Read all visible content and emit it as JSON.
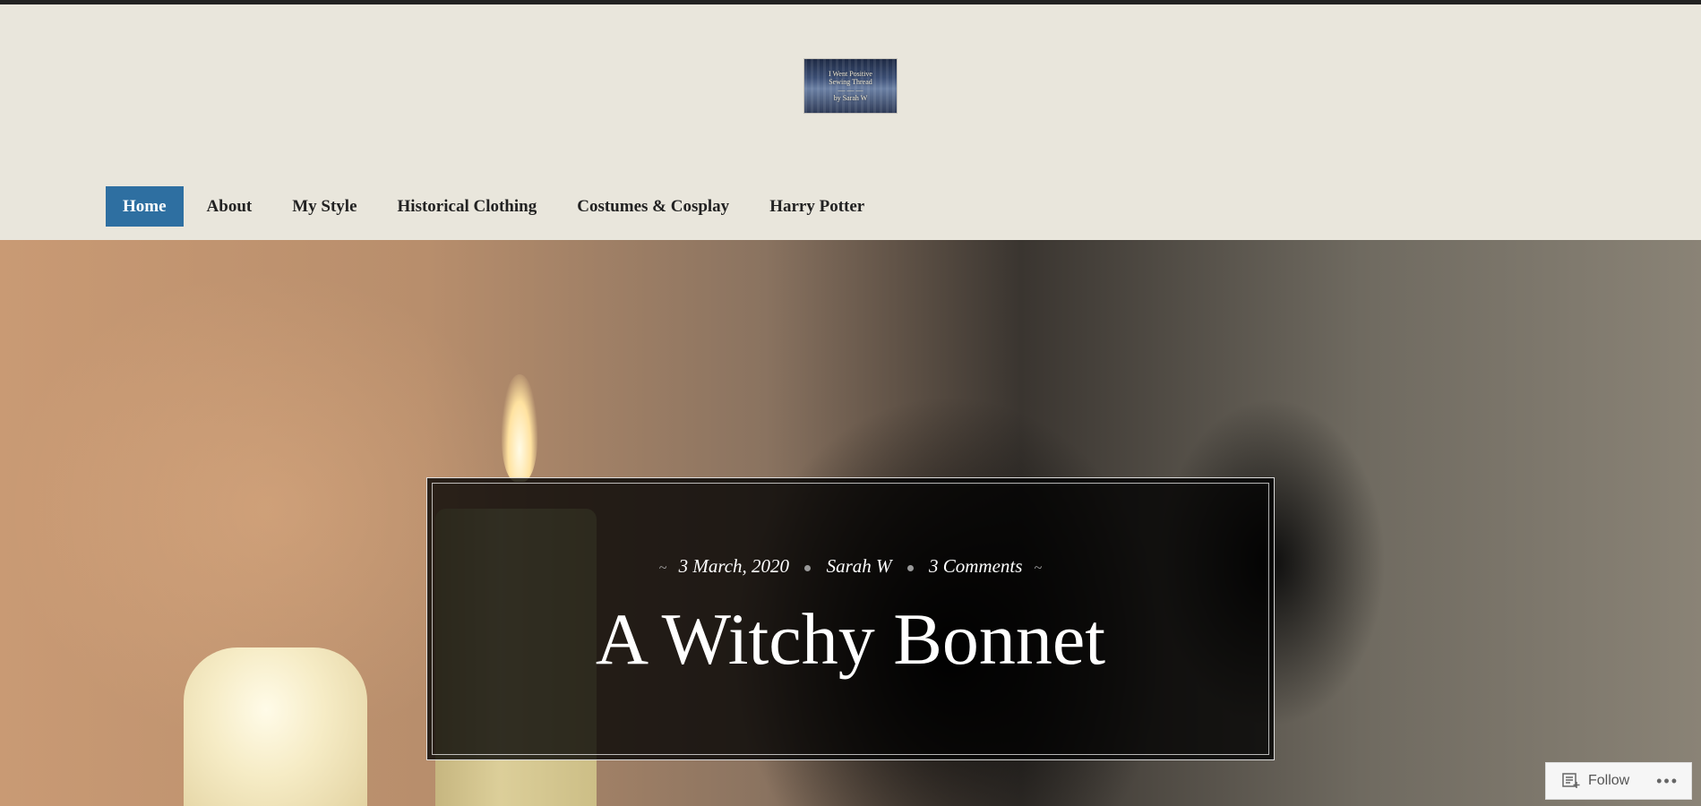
{
  "site": {
    "logo_lines": [
      "I Went Positive",
      "Sewing Thread",
      "—  —  —",
      "by Sarah W"
    ]
  },
  "nav": {
    "items": [
      {
        "label": "Home",
        "active": true
      },
      {
        "label": "About",
        "active": false
      },
      {
        "label": "My Style",
        "active": false
      },
      {
        "label": "Historical Clothing",
        "active": false
      },
      {
        "label": "Costumes & Cosplay",
        "active": false
      },
      {
        "label": "Harry Potter",
        "active": false
      }
    ]
  },
  "post": {
    "date": "3 March, 2020",
    "author": "Sarah W",
    "comments": "3 Comments",
    "title": "A Witchy Bonnet"
  },
  "follow_widget": {
    "label": "Follow",
    "more": "•••",
    "icon": "follow-reader-icon"
  },
  "colors": {
    "accent": "#2e6fa1",
    "header_bg": "#e9e6dc",
    "topbar": "#222222"
  }
}
